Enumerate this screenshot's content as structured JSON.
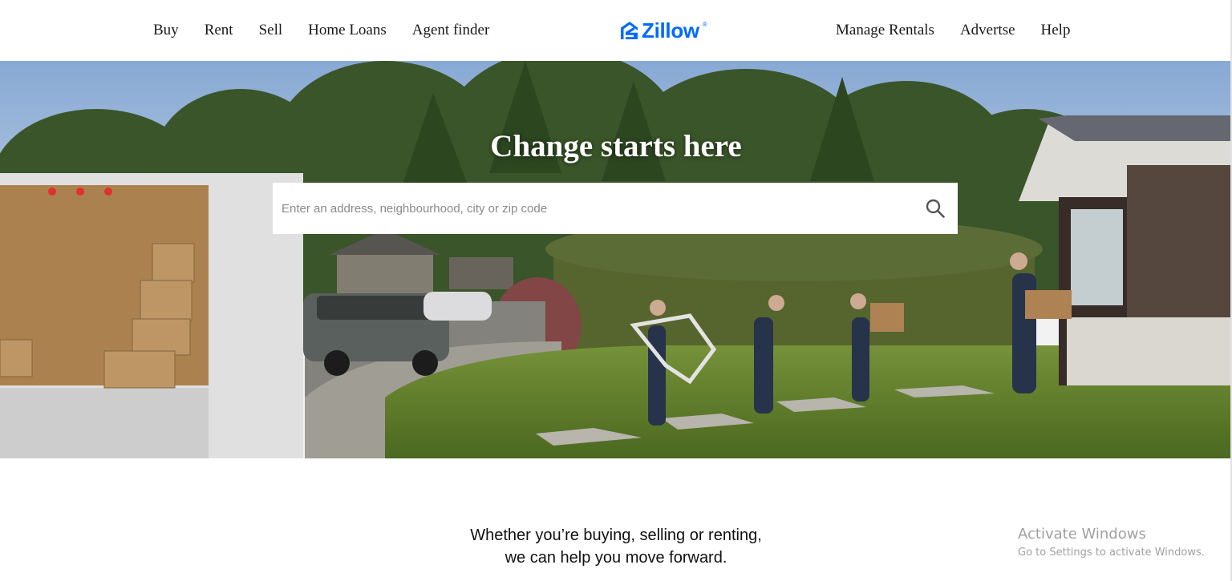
{
  "header": {
    "nav_left": [
      "Buy",
      "Rent",
      "Sell",
      "Home Loans",
      "Agent finder"
    ],
    "logo_text": "Zillow",
    "logo_mark": "®",
    "nav_right": [
      "Manage Rentals",
      "Advertse",
      "Help"
    ]
  },
  "hero": {
    "title": "Change starts here",
    "search": {
      "placeholder": "Enter an address, neighbourhood, city or zip code",
      "value": "",
      "icon": "search-icon"
    },
    "image": "family-moving-into-house-photo"
  },
  "tagline": {
    "line1": "Whether you’re buying, selling or renting,",
    "line2": "we can help you move forward."
  },
  "watermark": {
    "title": "Activate Windows",
    "subtitle": "Go to Settings to activate Windows."
  },
  "colors": {
    "brand": "#006aff",
    "nav_text": "#1a1a1a",
    "hero_title": "#ffffff"
  }
}
